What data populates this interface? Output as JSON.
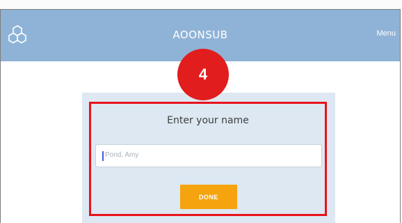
{
  "app": {
    "title": "AOONSUB",
    "menu_label": "Menu",
    "logo_icon": "hexagon-cluster-icon"
  },
  "annotation": {
    "step_number": "4"
  },
  "name_form": {
    "prompt": "Enter your name",
    "input_value": "",
    "input_placeholder": "Pond, Amy",
    "done_label": "DONE"
  },
  "colors": {
    "app_bar": "#8fb3d6",
    "card_background": "#dde8f2",
    "done_button": "#f5a30f",
    "annotation_red": "#e21d1d"
  }
}
